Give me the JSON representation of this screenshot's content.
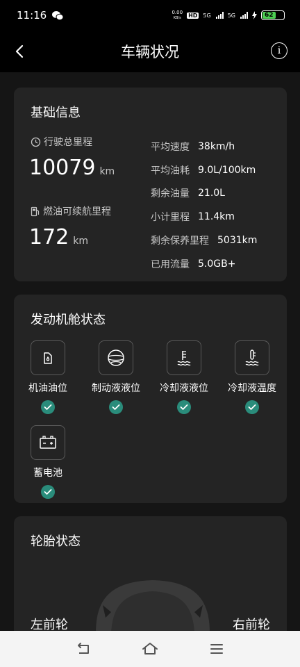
{
  "status_bar": {
    "time": "11:16",
    "net_rate": "0.00",
    "net_unit": "KB/s",
    "hd_label": "HD",
    "sim1_label": "5G",
    "sim2_label": "5G",
    "battery_level": "62",
    "battery_color": "#4ccf52"
  },
  "header": {
    "title": "车辆状况",
    "back_icon": "chevron-left-icon",
    "info_icon": "info-icon"
  },
  "basic_info": {
    "title": "基础信息",
    "total_mileage_label": "行驶总里程",
    "total_mileage_value": "10079",
    "total_mileage_unit": "km",
    "fuel_range_label": "燃油可续航里程",
    "fuel_range_value": "172",
    "fuel_range_unit": "km",
    "stats": [
      {
        "label": "平均速度",
        "value": "38km/h"
      },
      {
        "label": "平均油耗",
        "value": "9.0L/100km"
      },
      {
        "label": "剩余油量",
        "value": "21.0L"
      },
      {
        "label": "小计里程",
        "value": "11.4km"
      },
      {
        "label": "剩余保养里程",
        "value": "5031km"
      },
      {
        "label": "已用流量",
        "value": "5.0GB+"
      }
    ]
  },
  "engine": {
    "title": "发动机舱状态",
    "items": [
      {
        "label": "机油油位",
        "icon": "oil-can-icon"
      },
      {
        "label": "制动液液位",
        "icon": "brake-icon"
      },
      {
        "label": "冷却液液位",
        "icon": "coolant-level-icon"
      },
      {
        "label": "冷却液温度",
        "icon": "coolant-temp-icon"
      },
      {
        "label": "蓄电池",
        "icon": "battery-icon"
      }
    ],
    "status_color": "#2a8c7b"
  },
  "tire": {
    "title": "轮胎状态",
    "front_left": "左前轮",
    "front_right": "右前轮"
  },
  "bottom_nav": {
    "back_icon": "back-icon",
    "home_icon": "home-icon",
    "menu_icon": "menu-icon"
  }
}
